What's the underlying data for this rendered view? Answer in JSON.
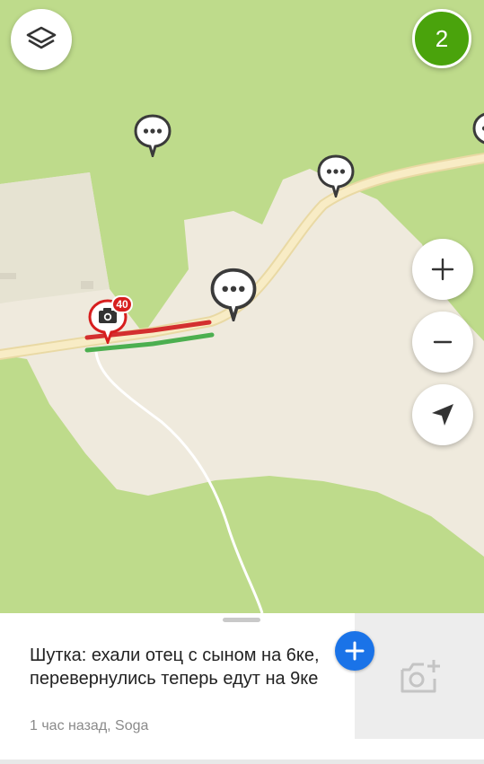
{
  "map": {
    "colors": {
      "grass": "#bedb8b",
      "clearing": "#efeadd",
      "road": "#f5e6b6",
      "traffic_heavy": "#d32f2f",
      "traffic_free": "#4caf50",
      "path": "#ffffff"
    },
    "controls": {
      "layers_icon": "layers-icon",
      "zoom_in_icon": "plus-icon",
      "zoom_out_icon": "minus-icon",
      "locate_icon": "navigation-arrow-icon"
    },
    "notifications_count": "2",
    "speed_camera": {
      "icon": "camera-icon",
      "speed_limit": "40"
    },
    "comment_pins_icon": "chat-bubble-icon"
  },
  "sheet": {
    "message": "Шутка: ехали отец с сыном на 6ке, перевернулись теперь едут на 9ке",
    "meta": "1 час назад, Soga",
    "add_icon": "plus-icon",
    "photo_icon": "add-photo-icon"
  }
}
